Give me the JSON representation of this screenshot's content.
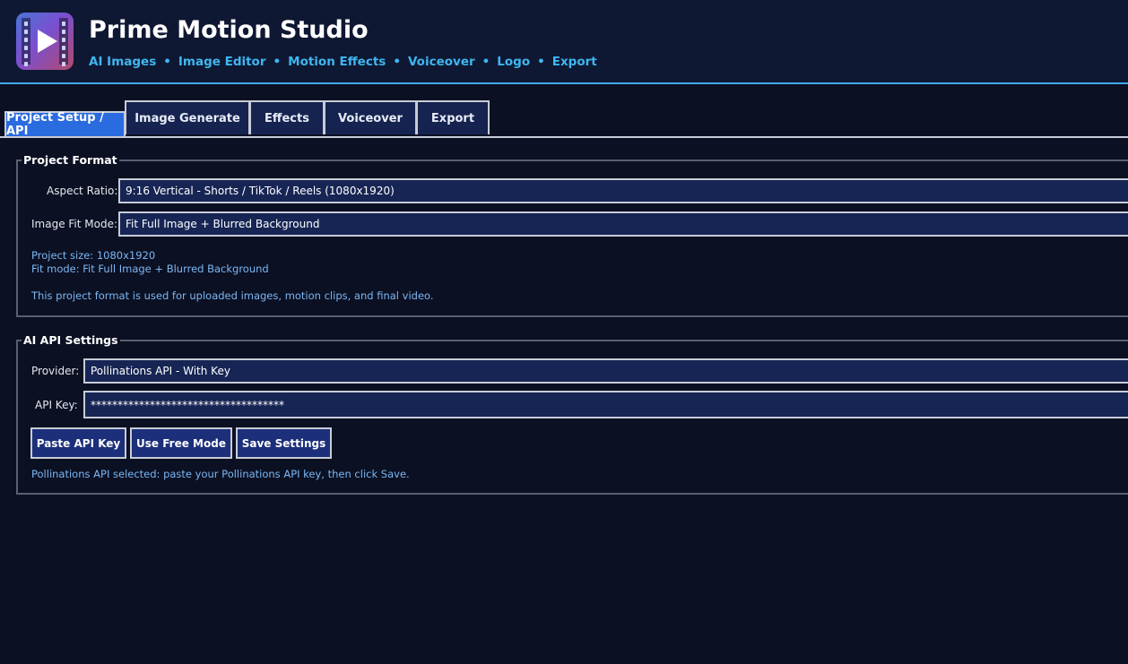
{
  "app": {
    "title": "Prime Motion Studio",
    "nav": [
      "AI Images",
      "Image Editor",
      "Motion Effects",
      "Voiceover",
      "Logo",
      "Export"
    ]
  },
  "tabs": [
    {
      "label": "Project Setup / API",
      "active": true
    },
    {
      "label": "Image Generate",
      "active": false
    },
    {
      "label": "Effects",
      "active": false
    },
    {
      "label": "Voiceover",
      "active": false
    },
    {
      "label": "Export",
      "active": false
    }
  ],
  "project_format": {
    "legend": "Project Format",
    "aspect_ratio_label": "Aspect Ratio:",
    "aspect_ratio_value": "9:16 Vertical - Shorts / TikTok / Reels (1080x1920)",
    "fit_mode_label": "Image Fit Mode:",
    "fit_mode_value": "Fit Full Image + Blurred Background",
    "size_info": "Project size: 1080x1920",
    "fit_info": "Fit mode: Fit Full Image + Blurred Background",
    "note": "This project format is used for uploaded images, motion clips, and final video."
  },
  "api_settings": {
    "legend": "AI API Settings",
    "provider_label": "Provider:",
    "provider_value": "Pollinations API - With Key",
    "api_key_label": "API Key:",
    "api_key_value": "************************************",
    "paste_button": "Paste API Key",
    "free_button": "Use Free Mode",
    "save_button": "Save Settings",
    "status": "Pollinations API selected: paste your Pollinations API key, then click Save."
  },
  "colors": {
    "background": "#0b1023",
    "header": "#0f1833",
    "accent": "#3fb6f0",
    "active_tab": "#2a6be0",
    "field": "#172554",
    "button": "#1c2f7a",
    "info_text": "#7cb7f2"
  },
  "icons": {
    "logo": "play-film-icon"
  }
}
